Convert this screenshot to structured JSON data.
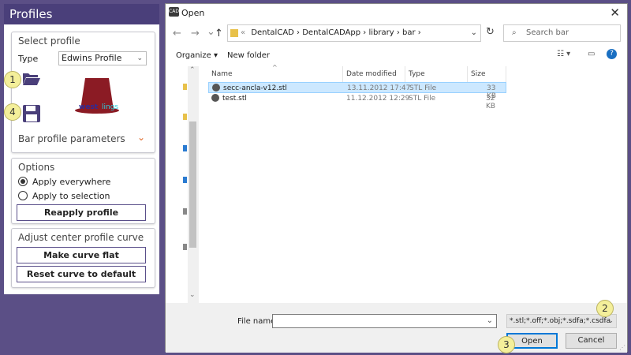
{
  "left": {
    "title": "Profiles",
    "select_profile": {
      "title": "Select profile",
      "type_label": "Type",
      "type_value": "Edwins Profile",
      "preview_text_1": "west",
      "preview_text_2": "lings",
      "params_label": "Bar profile parameters"
    },
    "options": {
      "title": "Options",
      "radio1": "Apply everywhere",
      "radio2": "Apply to selection",
      "reapply": "Reapply profile"
    },
    "curve": {
      "title": "Adjust center profile curve",
      "flat": "Make curve flat",
      "reset": "Reset curve to default"
    }
  },
  "callouts": {
    "c1": "1",
    "c2": "2",
    "c3": "3",
    "c4": "4"
  },
  "dialog": {
    "title": "Open",
    "app_icon": "cad-icon",
    "path_sep": "«",
    "path": [
      "DentalCAD",
      "DentalCADApp",
      "library",
      "bar"
    ],
    "search_placeholder": "Search bar",
    "organize": "Organize ▾",
    "new_folder": "New folder",
    "columns": [
      "Name",
      "Date modified",
      "Type",
      "Size"
    ],
    "files": [
      {
        "name": "secc-ancla-v12.stl",
        "date": "13.11.2012 17:47",
        "type": "STL File",
        "size": "33 KB",
        "selected": true
      },
      {
        "name": "test.stl",
        "date": "11.12.2012 12:29",
        "type": "STL File",
        "size": "32 KB",
        "selected": false
      }
    ],
    "filename_label": "File name:",
    "filename_value": "",
    "filter": "*.stl;*.off;*.obj;*.sdfa;*.csdfa",
    "open": "Open",
    "cancel": "Cancel"
  }
}
